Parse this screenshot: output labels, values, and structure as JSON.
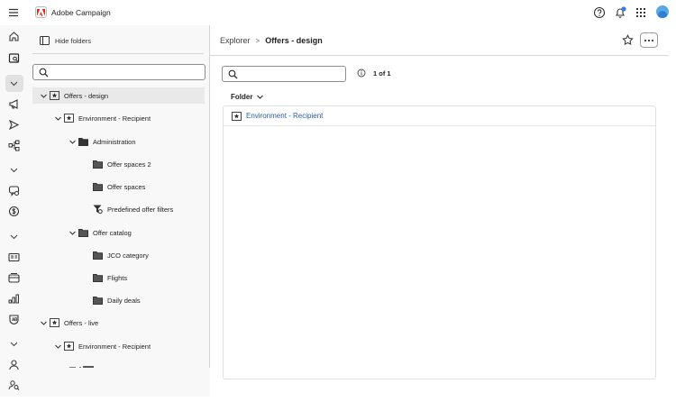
{
  "app": {
    "title": "Adobe Campaign"
  },
  "sidebar": {
    "hide_folders_label": "Hide folders",
    "search_placeholder": ""
  },
  "tree": [
    {
      "label": "Offers - design",
      "depth": 0,
      "icon": "star-folder",
      "expanded": true,
      "selected": true
    },
    {
      "label": "Environment - Recipient",
      "depth": 1,
      "icon": "star-folder",
      "expanded": true
    },
    {
      "label": "Administration",
      "depth": 2,
      "icon": "folder-dark",
      "expanded": true
    },
    {
      "label": "Offer spaces 2",
      "depth": 3,
      "icon": "folder"
    },
    {
      "label": "Offer spaces",
      "depth": 3,
      "icon": "folder"
    },
    {
      "label": "Predefined offer filters",
      "depth": 3,
      "icon": "filter"
    },
    {
      "label": "Offer catalog",
      "depth": 2,
      "icon": "folder",
      "expanded": true
    },
    {
      "label": "JCO category",
      "depth": 3,
      "icon": "folder"
    },
    {
      "label": "Flights",
      "depth": 3,
      "icon": "folder"
    },
    {
      "label": "Daily deals",
      "depth": 3,
      "icon": "folder"
    },
    {
      "label": "Offers - live",
      "depth": 0,
      "icon": "star-folder",
      "expanded": true
    },
    {
      "label": "Environment - Recipient",
      "depth": 1,
      "icon": "star-folder",
      "expanded": true
    }
  ],
  "breadcrumb": {
    "parent": "Explorer",
    "separator": ">",
    "current": "Offers - design"
  },
  "list": {
    "search_placeholder": "",
    "page_info": "1 of 1",
    "column_header": "Folder",
    "rows": [
      {
        "label": "Environment - Recipient",
        "icon": "star-folder"
      }
    ]
  },
  "colors": {
    "link": "#2b5ca8",
    "accent_logo": "#e1251b",
    "notification_dot": "#3a7be0"
  }
}
